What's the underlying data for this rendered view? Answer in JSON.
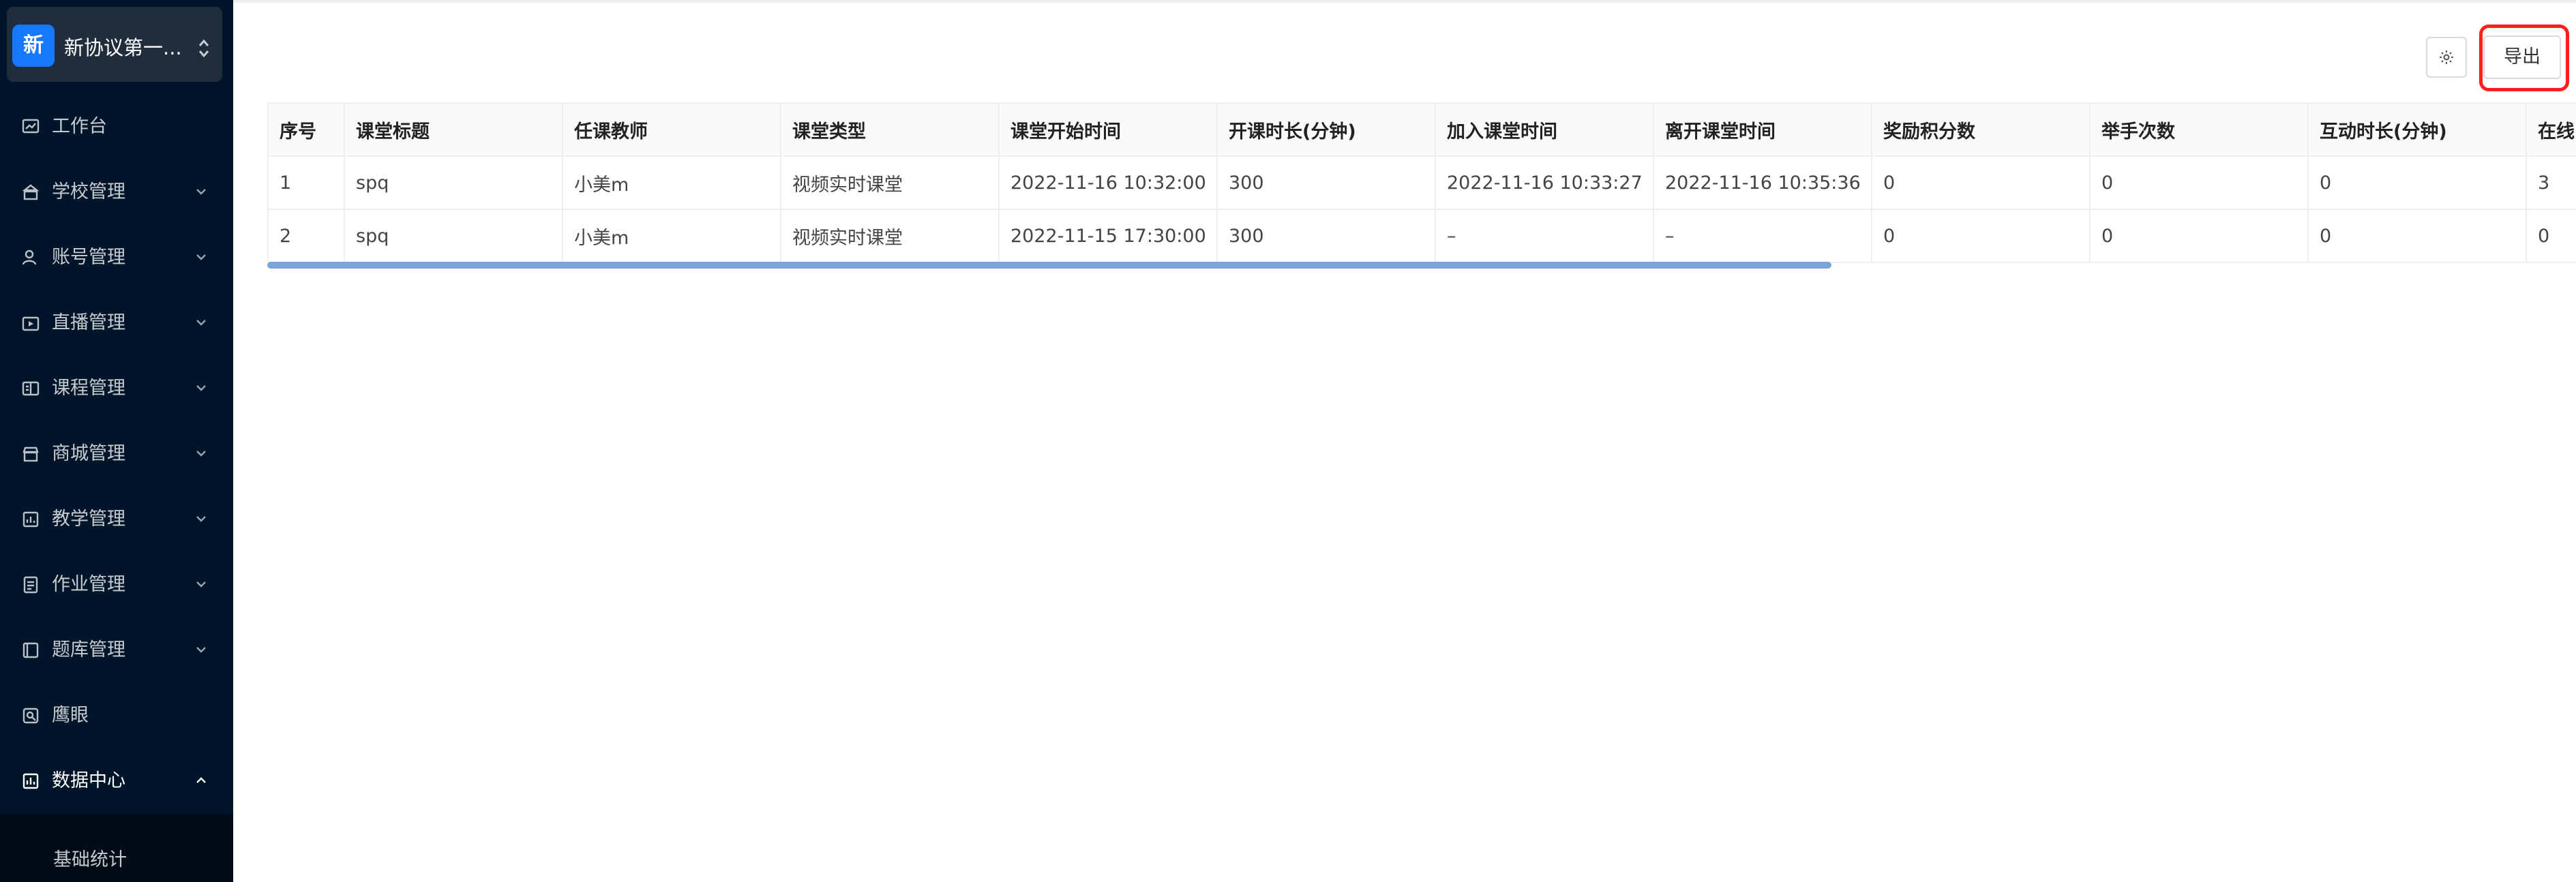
{
  "sidebar": {
    "org": {
      "logo_char": "新",
      "name": "新协议第一..."
    },
    "items": [
      {
        "label": "工作台",
        "icon": "dashboard-icon",
        "has_arrow": false
      },
      {
        "label": "学校管理",
        "icon": "school-icon",
        "has_arrow": true
      },
      {
        "label": "账号管理",
        "icon": "account-icon",
        "has_arrow": true
      },
      {
        "label": "直播管理",
        "icon": "live-icon",
        "has_arrow": true
      },
      {
        "label": "课程管理",
        "icon": "course-icon",
        "has_arrow": true
      },
      {
        "label": "商城管理",
        "icon": "shop-icon",
        "has_arrow": true
      },
      {
        "label": "教学管理",
        "icon": "teaching-icon",
        "has_arrow": true
      },
      {
        "label": "作业管理",
        "icon": "homework-icon",
        "has_arrow": true
      },
      {
        "label": "题库管理",
        "icon": "question-bank-icon",
        "has_arrow": true
      },
      {
        "label": "鹰眼",
        "icon": "hawkeye-icon",
        "has_arrow": false
      },
      {
        "label": "数据中心",
        "icon": "data-center-icon",
        "has_arrow": true,
        "expanded": true
      }
    ],
    "submenu": {
      "label": "基础统计"
    }
  },
  "toolbar": {
    "settings_icon": "gear-icon",
    "export_label": "导出",
    "highlight_color": "#ff1f1f"
  },
  "table": {
    "columns": [
      "序号",
      "课堂标题",
      "任课教师",
      "课堂类型",
      "课堂开始时间",
      "开课时长(分钟)",
      "加入课堂时间",
      "离开课堂时间",
      "奖励积分数",
      "举手次数",
      "互动时长(分钟)",
      "在线"
    ],
    "rows": [
      [
        "1",
        "spq",
        "小美m",
        "视频实时课堂",
        "2022-11-16 10:32:00",
        "300",
        "2022-11-16 10:33:27",
        "2022-11-16 10:35:36",
        "0",
        "0",
        "0",
        "3"
      ],
      [
        "2",
        "spq",
        "小美m",
        "视频实时课堂",
        "2022-11-15 17:30:00",
        "300",
        "–",
        "–",
        "0",
        "0",
        "0",
        "0"
      ]
    ]
  },
  "colors": {
    "sidebar_bg": "#001529",
    "accent": "#1677ff",
    "scrollbar": "#7da4d6"
  }
}
